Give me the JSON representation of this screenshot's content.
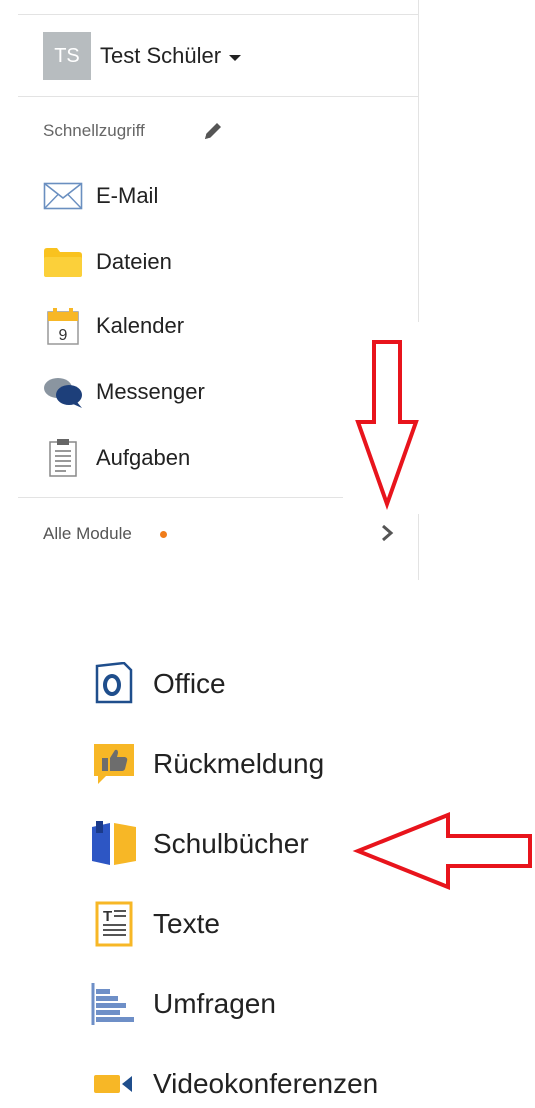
{
  "user": {
    "initials": "TS",
    "name": "Test Schüler"
  },
  "quick_access": {
    "label": "Schnellzugriff",
    "items": [
      {
        "label": "E-Mail",
        "icon": "mail-icon"
      },
      {
        "label": "Dateien",
        "icon": "folder-icon"
      },
      {
        "label": "Kalender",
        "icon": "calendar-icon"
      },
      {
        "label": "Messenger",
        "icon": "messenger-icon"
      },
      {
        "label": "Aufgaben",
        "icon": "tasks-icon"
      }
    ],
    "calendar_day": "9"
  },
  "modules": {
    "label": "Alle Module"
  },
  "module_list": [
    {
      "label": "Office",
      "icon": "office-icon"
    },
    {
      "label": "Rückmeldung",
      "icon": "feedback-icon"
    },
    {
      "label": "Schulbücher",
      "icon": "schoolbooks-icon"
    },
    {
      "label": "Texte",
      "icon": "texts-icon"
    },
    {
      "label": "Umfragen",
      "icon": "surveys-icon"
    },
    {
      "label": "Videokonferenzen",
      "icon": "video-icon"
    }
  ],
  "colors": {
    "accent_orange": "#f07c1a",
    "annotation_red": "#e8141c",
    "folder_yellow": "#f9c21f",
    "office_blue": "#1f4e8c"
  }
}
